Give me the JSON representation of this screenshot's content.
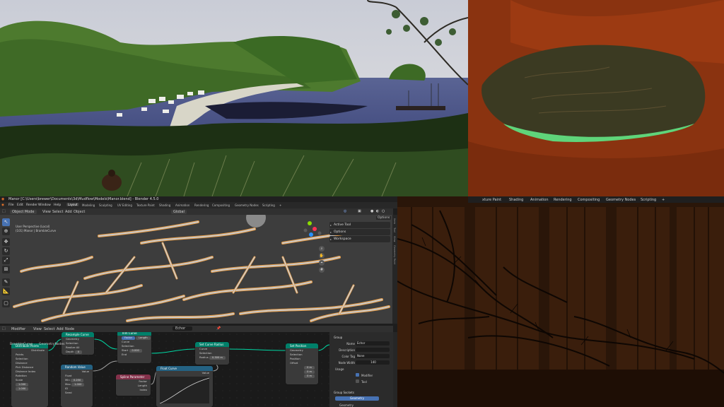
{
  "window": {
    "title": "Manor [C:\\Users\\brewer\\Documents\\3d\\Mudflow\\Models\\Manor.blend] - Blender 4.5.0"
  },
  "menu": [
    "File",
    "Edit",
    "Render",
    "Window",
    "Help"
  ],
  "workspaces": [
    "Layout",
    "Modeling",
    "Sculpting",
    "UV Editing",
    "Texture Paint",
    "Shading",
    "Animation",
    "Rendering",
    "Compositing",
    "Geometry Nodes",
    "Scripting"
  ],
  "workspaces_right": [
    "xture Paint",
    "Shading",
    "Animation",
    "Rendering",
    "Compositing",
    "Geometry Nodes",
    "Scripting",
    "+"
  ],
  "viewport": {
    "mode": "Object Mode",
    "view_menu": [
      "View",
      "Select",
      "Add",
      "Object"
    ],
    "orientation": "Global",
    "info_lines": [
      "User Perspective (Local)",
      "(101) Manor | BrambleCurve"
    ],
    "options_label": "Options",
    "npanel": [
      "Active Tool",
      "Options",
      "Workspace"
    ],
    "side_tabs": [
      "Item",
      "Tool",
      "View",
      "Geometry Paint"
    ]
  },
  "node_editor": {
    "header_mode": "Modifier",
    "menus": [
      "View",
      "Select",
      "Add",
      "Node"
    ],
    "group_name": "Echor",
    "breadcrumb": [
      "BrambleCurve",
      "GeometryNodes"
    ],
    "nodes": {
      "distribute": {
        "title": "Distribute Points",
        "rows": [
          "Distribute",
          "Points",
          "Selection",
          "Distance",
          "Pick Distance",
          "Distance Index",
          "Rotation",
          "Scale"
        ]
      },
      "sample": {
        "title": "Resample Curve",
        "rows": [
          "Geometry",
          "Selection",
          "Realize All",
          "Depth"
        ],
        "depth_value": "0"
      },
      "trim": {
        "title": "Trim Curve",
        "tabs": [
          "Factor",
          "Length"
        ],
        "rows": [
          "Curve",
          "Selection",
          "Start",
          "End"
        ],
        "start_value": "0.000"
      },
      "random": {
        "title": "Random Value",
        "rows": [
          "Value",
          "Float",
          "Min",
          "Max",
          "ID",
          "Seed"
        ],
        "min_value": "0.250",
        "max_value": "1.000"
      },
      "spline": {
        "title": "Spline Parameter",
        "rows": [
          "Factor",
          "Length",
          "Index"
        ]
      },
      "float_curve": {
        "title": "Float Curve",
        "rows": [
          "Value"
        ]
      },
      "radius": {
        "title": "Set Curve Radius",
        "rows": [
          "Curve",
          "Selection",
          "Radius"
        ],
        "radius_value": "0.300 m"
      },
      "position": {
        "title": "Set Position",
        "rows": [
          "Geometry",
          "Selection",
          "Position",
          "Offset"
        ],
        "offset_values": [
          "0 m",
          "0 m",
          "0 m"
        ]
      },
      "scale_values": [
        "1.000",
        "1.000",
        "1.000"
      ]
    }
  },
  "group_panel": {
    "section": "Group",
    "fields": [
      {
        "label": "Name",
        "value": "Echor"
      },
      {
        "label": "Description",
        "value": ""
      },
      {
        "label": "Color Tag",
        "value": "None"
      },
      {
        "label": "Node Width",
        "value": "140"
      }
    ],
    "usage_section": "Usage",
    "usage_checks": [
      "Modifier",
      "Tool"
    ],
    "sockets_section": "Group Sockets",
    "socket_items": [
      "Geometry",
      "Geometry"
    ]
  }
}
